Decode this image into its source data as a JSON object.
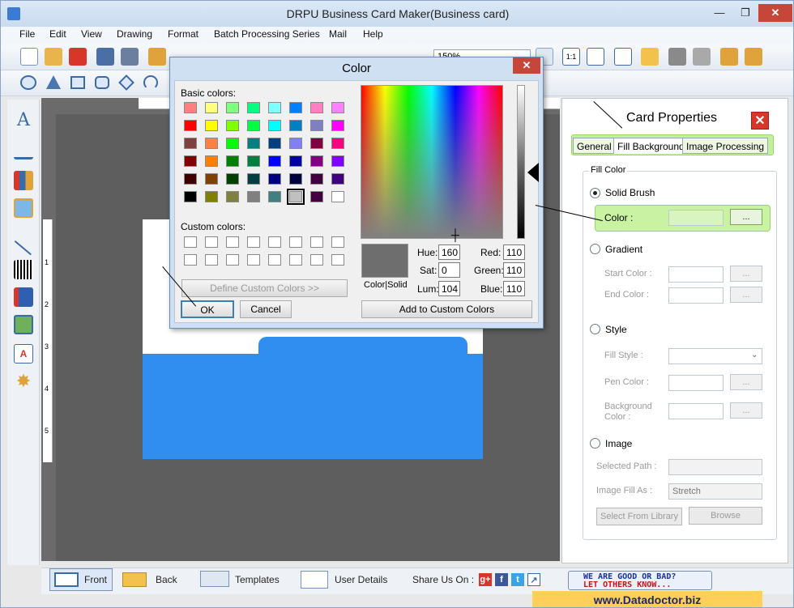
{
  "window": {
    "title": "DRPU Business Card Maker(Business card)",
    "minimize": "—",
    "restore": "❐",
    "close": "✕"
  },
  "menu": [
    "File",
    "Edit",
    "View",
    "Drawing",
    "Format",
    "Batch Processing Series",
    "Mail",
    "Help"
  ],
  "toolbar": {
    "zoom_value": "150%"
  },
  "ruler": {
    "v_marks": [
      "1",
      "2",
      "3",
      "4",
      "5"
    ]
  },
  "card_properties": {
    "title": "Card Properties",
    "close": "✕",
    "tabs": [
      "General",
      "Fill Background",
      "Image Processing"
    ],
    "active_tab": "Fill Background",
    "group_title": "Fill Color",
    "solid_brush": "Solid Brush",
    "color_label": "Color :",
    "browse_dots": "...",
    "gradient": "Gradient",
    "start_color": "Start Color :",
    "end_color": "End Color :",
    "style": "Style",
    "fill_style": "Fill Style :",
    "pen_color": "Pen Color :",
    "background_color_1": "Background",
    "background_color_2": "Color :",
    "image": "Image",
    "selected_path": "Selected Path :",
    "image_fill_as": "Image Fill As :",
    "image_fill_value": "Stretch",
    "select_from_library": "Select From Library",
    "browse": "Browse"
  },
  "color_dialog": {
    "title": "Color",
    "close": "✕",
    "basic_colors_label": "Basic colors:",
    "custom_colors_label": "Custom colors:",
    "define_custom": "Define Custom Colors >>",
    "ok": "OK",
    "cancel": "Cancel",
    "color_solid": "Color|Solid",
    "hue_label": "Hue:",
    "hue": "160",
    "sat_label": "Sat:",
    "sat": "0",
    "lum_label": "Lum:",
    "lum": "104",
    "red_label": "Red:",
    "red": "110",
    "green_label": "Green:",
    "green": "110",
    "blue_label": "Blue:",
    "blue": "110",
    "add_custom": "Add to Custom Colors",
    "basic_colors": [
      "#ff8080",
      "#ffff80",
      "#80ff80",
      "#00ff80",
      "#80ffff",
      "#0080ff",
      "#ff80c0",
      "#ff80ff",
      "#ff0000",
      "#ffff00",
      "#80ff00",
      "#00ff40",
      "#00ffff",
      "#0080c0",
      "#8080c0",
      "#ff00ff",
      "#804040",
      "#ff8040",
      "#00ff00",
      "#008080",
      "#004080",
      "#8080ff",
      "#800040",
      "#ff0080",
      "#800000",
      "#ff8000",
      "#008000",
      "#008040",
      "#0000ff",
      "#0000a0",
      "#800080",
      "#8000ff",
      "#400000",
      "#804000",
      "#004000",
      "#004040",
      "#000080",
      "#000040",
      "#400040",
      "#400080",
      "#000000",
      "#808000",
      "#808040",
      "#808080",
      "#408080",
      "#c0c0c0",
      "#400040",
      "#ffffff"
    ],
    "selected_index": 45
  },
  "statusbar": {
    "front": "Front",
    "back": "Back",
    "templates": "Templates",
    "user_details": "User Details",
    "share": "Share Us On :",
    "feedback_1": "WE ARE GOOD OR BAD?",
    "feedback_2": "LET OTHERS KNOW..."
  },
  "banner": "www.Datadoctor.biz",
  "colors": {
    "card_blue": "#2f8ef0",
    "highlight_green": "#c9f2a2",
    "preview_gray": "#6e6e6e"
  }
}
